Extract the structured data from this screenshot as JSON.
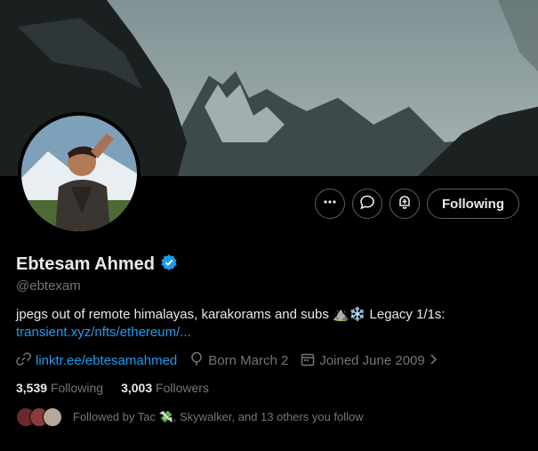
{
  "profile": {
    "name": "Ebtesam Ahmed",
    "handle": "@ebtexam",
    "bio_text": "jpegs out of remote himalayas, karakorams and subs ⛰️❄️ Legacy 1/1s:",
    "bio_link": "transient.xyz/nfts/ethereum/...",
    "website": "linktr.ee/ebtesamahmed",
    "born": "Born March 2",
    "joined": "Joined June 2009"
  },
  "stats": {
    "following_count": "3,539",
    "following_label": "Following",
    "followers_count": "3,003",
    "followers_label": "Followers"
  },
  "actions": {
    "follow_label": "Following"
  },
  "followed_by": {
    "text": "Followed by Tac 💸, Skywalker, and 13 others you follow"
  },
  "colors": {
    "accent": "#1d9bf0",
    "muted": "#71767b",
    "text": "#e7e9ea",
    "border": "#536471"
  }
}
